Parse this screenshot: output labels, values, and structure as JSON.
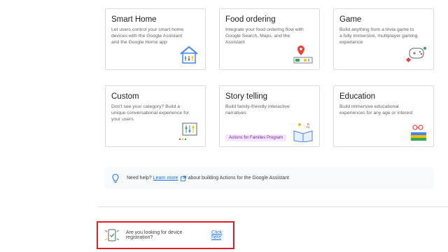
{
  "cards": [
    {
      "title": "Smart Home",
      "desc": "Let users control your smart home devices with the Google Assistant and the Google Home app",
      "icon": "smart-home-icon"
    },
    {
      "title": "Food ordering",
      "desc": "Integrate your food ordering flow with Google Search, Maps, and the Assistant",
      "icon": "food-ordering-icon"
    },
    {
      "title": "Game",
      "desc": "Build anything from a trivia game to a fully immersive, multiplayer gaming experience",
      "icon": "game-icon"
    },
    {
      "title": "Custom",
      "desc": "Don't see your category? Build a unique conversational experience for your users",
      "icon": "custom-icon"
    },
    {
      "title": "Story telling",
      "desc": "Build family-friendly interactive narratives",
      "icon": "story-telling-icon",
      "badge": "Actions for Families Program"
    },
    {
      "title": "Education",
      "desc": "Build immersive educational experiences for any age or interest",
      "icon": "education-icon"
    }
  ],
  "help": {
    "prefix": "Need help?",
    "link": "Learn more",
    "suffix": "about building Actions for the Google Assistant"
  },
  "registration": {
    "text": "Are you looking for device registration?",
    "link": "Click here"
  },
  "colors": {
    "link": "#1a73e8",
    "highlight": "#e51c23",
    "badge_bg": "#f3e8fd"
  }
}
